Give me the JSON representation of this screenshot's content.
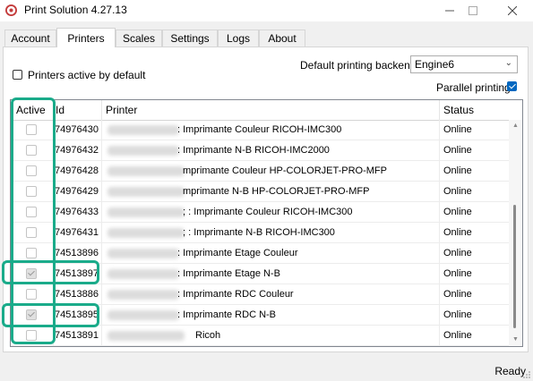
{
  "window": {
    "title": "Print Solution 4.27.13",
    "minimize_icon": "minimize-icon",
    "maximize_icon": "maximize-icon",
    "close_icon": "close-icon",
    "app_icon": "print-solution-logo-icon",
    "accent": "#c43c3c"
  },
  "tabs": [
    {
      "label": "Account",
      "active": false
    },
    {
      "label": "Printers",
      "active": true
    },
    {
      "label": "Scales",
      "active": false
    },
    {
      "label": "Settings",
      "active": false
    },
    {
      "label": "Logs",
      "active": false
    },
    {
      "label": "About",
      "active": false
    }
  ],
  "options": {
    "active_by_default_label": "Printers active by default",
    "active_by_default_checked": false,
    "backend_label": "Default printing backend",
    "backend_value": "Engine6",
    "parallel_label": "Parallel printing",
    "parallel_checked": true
  },
  "table": {
    "headers": {
      "active": "Active",
      "id": "Id",
      "printer": "Printer",
      "status": "Status"
    },
    "rows": [
      {
        "active": false,
        "id": "74976430",
        "printer": " : Imprimante Couleur RICOH-IMC300",
        "status": "Online"
      },
      {
        "active": false,
        "id": "74976432",
        "printer": " : Imprimante N-B RICOH-IMC2000",
        "status": "Online"
      },
      {
        "active": false,
        "id": "74976428",
        "printer": "mprimante Couleur HP-COLORJET-PRO-MFP",
        "status": "Online"
      },
      {
        "active": false,
        "id": "74976429",
        "printer": "mprimante N-B HP-COLORJET-PRO-MFP",
        "status": "Online"
      },
      {
        "active": false,
        "id": "74976433",
        "printer": "; : Imprimante Couleur RICOH-IMC300",
        "status": "Online"
      },
      {
        "active": false,
        "id": "74976431",
        "printer": "; : Imprimante N-B RICOH-IMC300",
        "status": "Online"
      },
      {
        "active": false,
        "id": "74513896",
        "printer": " : Imprimante  Etage Couleur",
        "status": "Online"
      },
      {
        "active": true,
        "id": "74513897",
        "printer": " : Imprimante  Etage N-B",
        "status": "Online"
      },
      {
        "active": false,
        "id": "74513886",
        "printer": " : Imprimante  RDC Couleur",
        "status": "Online"
      },
      {
        "active": true,
        "id": "74513895",
        "printer": " : Imprimante  RDC N-B",
        "status": "Online"
      },
      {
        "active": false,
        "id": "74513891",
        "printer": "Ricoh",
        "status": "Online"
      }
    ]
  },
  "status_bar": {
    "text": "Ready"
  },
  "highlight_color": "#1aab8a"
}
